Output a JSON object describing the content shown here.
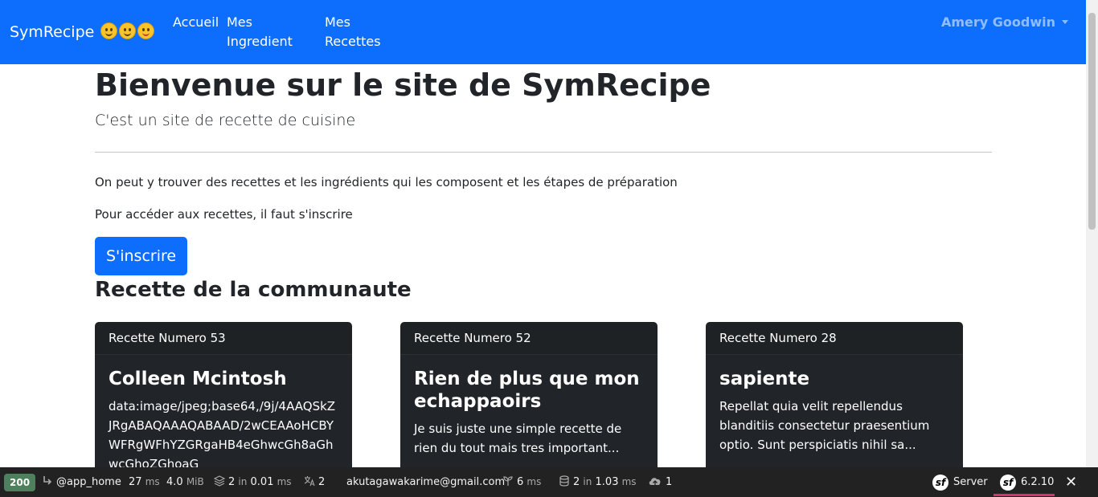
{
  "navbar": {
    "brand": "SymRecipe",
    "home": "Accueil",
    "ingredients": "Mes Ingredient",
    "recipes": "Mes Recettes",
    "user": "Amery Goodwin"
  },
  "main": {
    "title": "Bienvenue sur le site de SymRecipe",
    "subtitle": "C'est un site de recette de cuisine",
    "paragraph1": "On peut y trouver des recettes et les ingrédients qui les composent et les étapes de préparation",
    "paragraph2": "Pour accéder aux recettes, il faut s'inscrire",
    "signup_button": "S'inscrire",
    "community_heading": "Recette de la communaute"
  },
  "cards": [
    {
      "header": "Recette Numero 53",
      "title": "Colleen Mcintosh",
      "text": "data:image/jpeg;base64,/9j/4AAQSkZJRgABAQAAAQABAAD/2wCEAAoHCBYWFRgWFhYZGRgaHB4eGhwcGh8aGhwcGhoZGhoaG"
    },
    {
      "header": "Recette Numero 52",
      "title": "Rien de plus que mon echappaoirs",
      "text": "Je suis juste une simple recette de rien du tout mais tres important..."
    },
    {
      "header": "Recette Numero 28",
      "title": "sapiente",
      "text": "Repellat quia velit repellendus blanditiis consectetur praesentium optio. Sunt perspiciatis nihil sa..."
    }
  ],
  "toolbar": {
    "status": "200",
    "route": "@app_home",
    "time_value": "27",
    "time_unit": "ms",
    "memory_value": "4.0",
    "memory_unit": "MiB",
    "cache_value": "2",
    "cache_in": "in",
    "cache_time": "0.01",
    "cache_unit": "ms",
    "translation_count": "2",
    "user_email": "akutagawakarime@gmail.com",
    "twig_value": "6",
    "twig_unit": "ms",
    "db_value": "2",
    "db_in": "in",
    "db_time": "1.03",
    "db_unit": "ms",
    "http_value": "1",
    "server_label": "Server",
    "version": "6.2.10",
    "close": "✕"
  },
  "colors": {
    "primary": "#0d6efd",
    "card_bg": "#212529",
    "toolbar_bg": "#222222",
    "status_green": "#4f805d"
  }
}
